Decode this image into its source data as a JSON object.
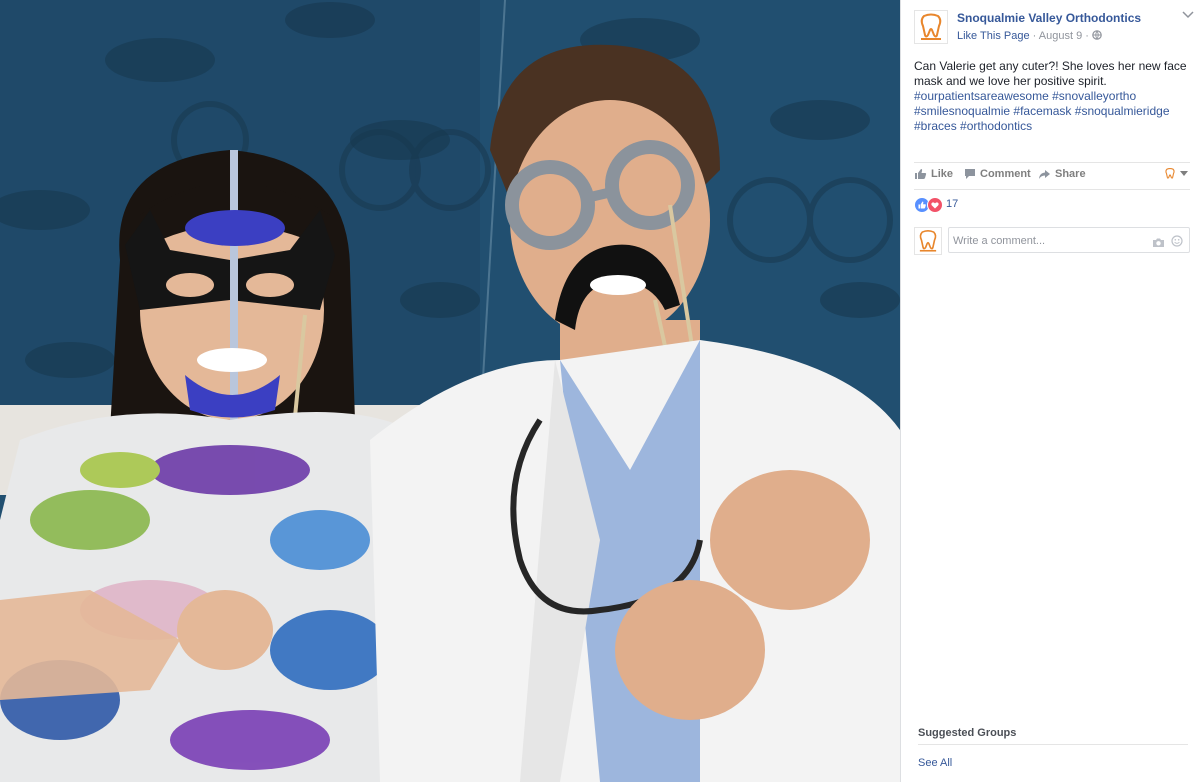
{
  "post": {
    "page_name": "Snoqualmie Valley Orthodontics",
    "like_page": "Like This Page",
    "separator": "·",
    "date": "August 9",
    "audience_icon": "globe-icon",
    "caption_text": "Can Valerie get any cuter?! She loves her new face mask and we love her positive spirit.",
    "hashtags": [
      "#ourpatientsareawesome",
      "#snovalleyortho",
      "#smilesnoqualmie",
      "#facemask",
      "#snoqualmieridge",
      "#braces",
      "#orthodontics"
    ]
  },
  "actions": {
    "like": "Like",
    "comment": "Comment",
    "share": "Share"
  },
  "reactions": {
    "count": "17",
    "types": [
      "like",
      "love"
    ]
  },
  "comment_box": {
    "placeholder": "Write a comment..."
  },
  "sidebar": {
    "suggested_groups": "Suggested Groups",
    "see_all": "See All"
  },
  "colors": {
    "link": "#365899",
    "like_blue": "#5890ff",
    "love_red": "#f25268",
    "logo_orange": "#e8862c"
  }
}
